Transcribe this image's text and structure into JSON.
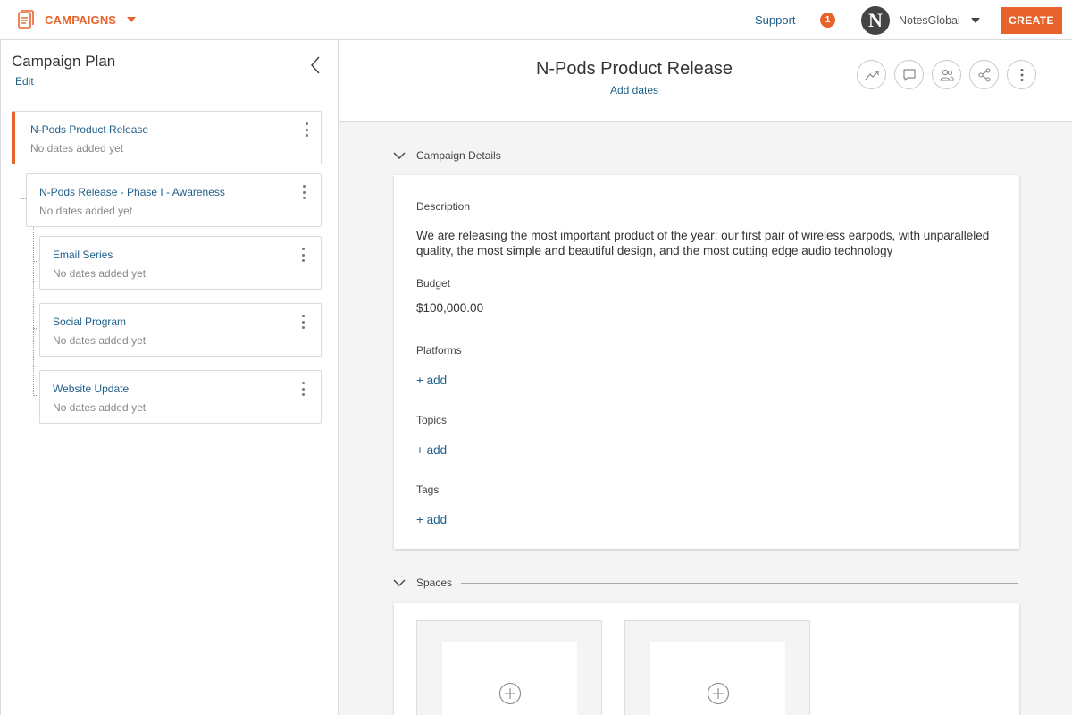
{
  "topbar": {
    "brand_label": "CAMPAIGNS",
    "support_label": "Support",
    "notification_count": "1",
    "avatar_initial": "N",
    "account_name": "NotesGlobal",
    "create_label": "CREATE",
    "accent_color": "#e8632b"
  },
  "sidebar": {
    "title": "Campaign Plan",
    "edit_label": "Edit",
    "items": [
      {
        "title": "N-Pods Product Release",
        "subtitle": "No dates added yet"
      },
      {
        "title": "N-Pods Release - Phase I - Awareness",
        "subtitle": "No dates added yet"
      },
      {
        "title": "Email Series",
        "subtitle": "No dates added yet"
      },
      {
        "title": "Social Program",
        "subtitle": "No dates added yet"
      },
      {
        "title": "Website Update",
        "subtitle": "No dates added yet"
      }
    ]
  },
  "main": {
    "title": "N-Pods Product Release",
    "add_dates_label": "Add dates",
    "header_actions": [
      "trend-icon",
      "comment-icon",
      "people-icon",
      "share-icon",
      "more-icon"
    ],
    "details": {
      "section_label": "Campaign Details",
      "description_label": "Description",
      "description_value": "We are releasing  the most important product of the year: our first pair of wireless earpods, with unparalleled quality, the most simple and beautiful design, and the most cutting edge audio technology",
      "budget_label": "Budget",
      "budget_value": "$100,000.00",
      "platforms_label": "Platforms",
      "platforms_add": "+ add",
      "topics_label": "Topics",
      "topics_add": "+ add",
      "tags_label": "Tags",
      "tags_add": "+ add"
    },
    "spaces": {
      "section_label": "Spaces"
    }
  }
}
